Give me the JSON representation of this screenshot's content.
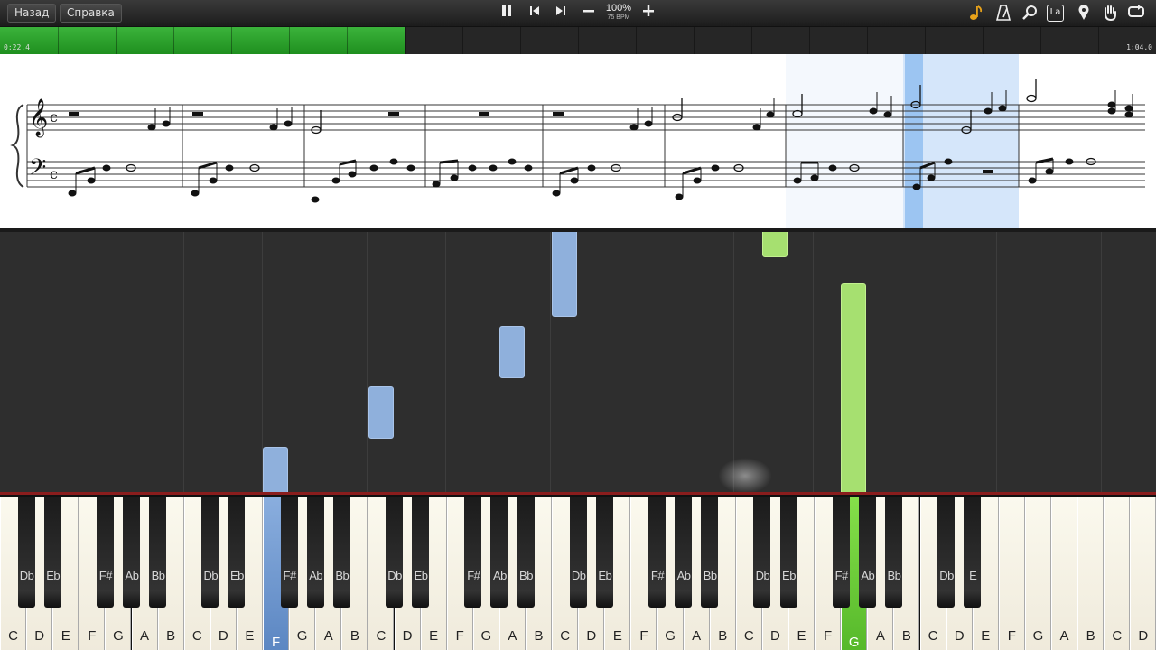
{
  "toolbar": {
    "back_label": "Назад",
    "help_label": "Справка",
    "speed_percent": "100%",
    "tempo": "75 BPM",
    "icons": [
      "pause-icon",
      "rewind-icon",
      "forward-icon",
      "minus-icon",
      "plus-icon",
      "note-icon",
      "metronome-icon",
      "magnifier-icon",
      "la-icon",
      "marker-icon",
      "hand-icon",
      "loop-icon"
    ],
    "la_label": "La"
  },
  "progress": {
    "elapsed": "0:22.4",
    "total": "1:04.0",
    "fraction": 0.35,
    "fill_color": "#2ea82e"
  },
  "keyboard": {
    "white_notes": [
      "C",
      "D",
      "E",
      "F",
      "G",
      "A",
      "B",
      "C",
      "D",
      "E",
      "F",
      "G",
      "A",
      "B",
      "C",
      "D",
      "E",
      "F",
      "G",
      "A",
      "B",
      "C",
      "D",
      "E",
      "F",
      "G",
      "A",
      "B",
      "C",
      "D",
      "E",
      "F",
      "G",
      "A",
      "B",
      "C",
      "D",
      "E",
      "F",
      "G",
      "A",
      "B",
      "C",
      "D"
    ],
    "black_notes": [
      "Db",
      "Eb",
      "F#",
      "Ab",
      "Bb",
      "Db",
      "Eb",
      "F#",
      "Ab",
      "Bb",
      "Db",
      "Eb",
      "F#",
      "Ab",
      "Bb",
      "Db",
      "Eb",
      "F#",
      "Ab",
      "Bb",
      "Db",
      "Eb",
      "F#",
      "Ab",
      "Bb",
      "Db",
      "E"
    ],
    "active_left_hand": "F",
    "active_right_hand": "G",
    "left_hand_color": "#8fb0dc",
    "right_hand_color": "#a6e070"
  }
}
